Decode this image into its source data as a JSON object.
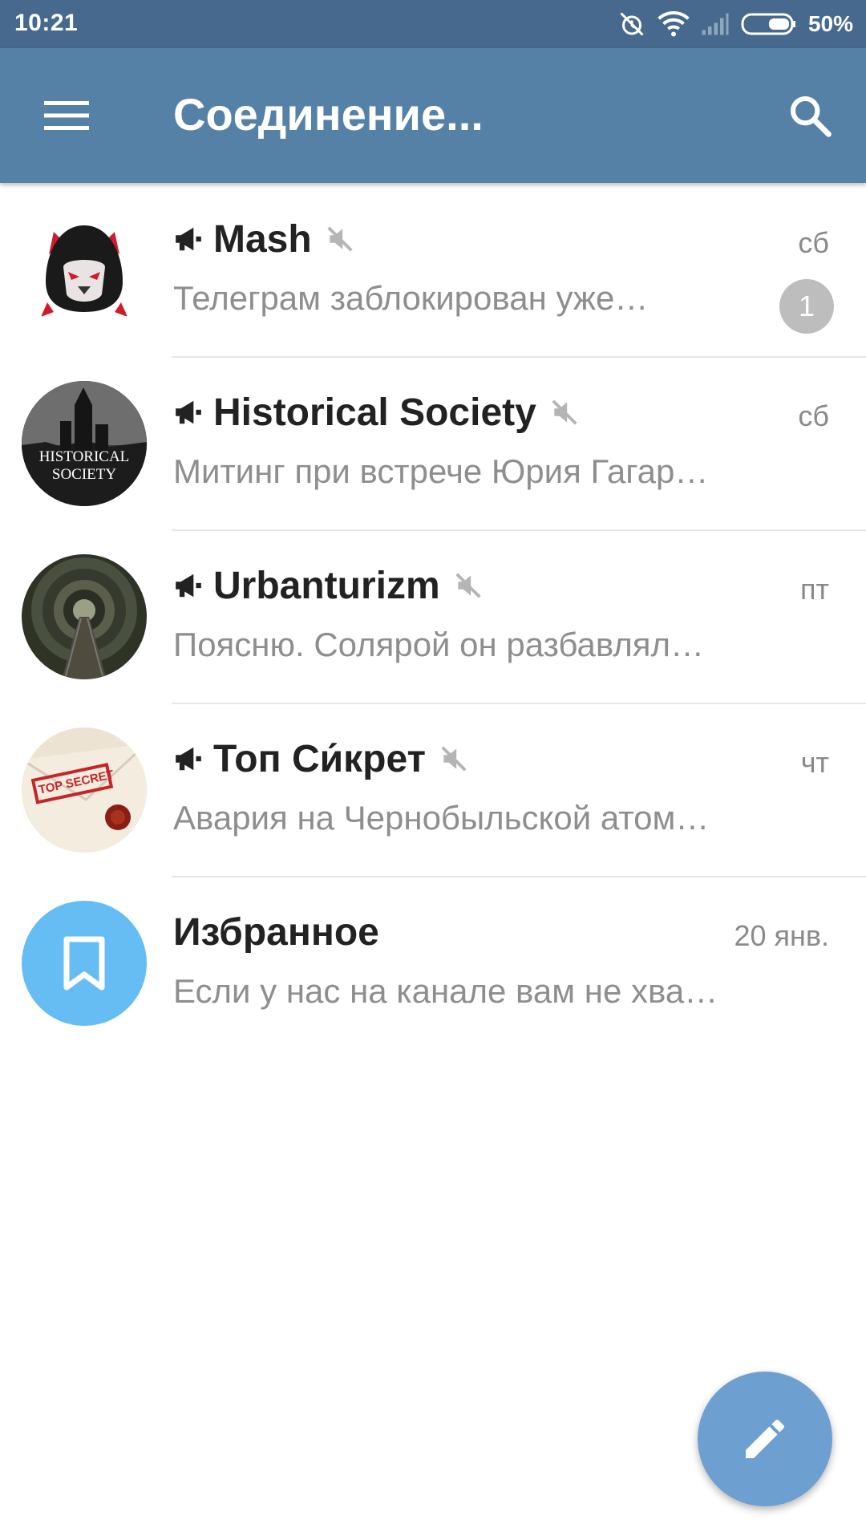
{
  "status_bar": {
    "time": "10:21",
    "battery": "50%",
    "icons": [
      "alarm-off-icon",
      "wifi-icon",
      "signal-icon",
      "battery-icon"
    ]
  },
  "toolbar": {
    "title": "Соединение...",
    "menu_icon": "hamburger-menu-icon",
    "search_icon": "search-icon"
  },
  "chats": [
    {
      "name": "Mash",
      "channel": true,
      "muted": true,
      "date": "сб",
      "preview": "Телеграм заблокирован уже…",
      "unread": "1",
      "avatar": "mash-avatar"
    },
    {
      "name": "Historical Society",
      "channel": true,
      "muted": true,
      "date": "сб",
      "preview": "Митинг при встрече Юрия Гагар…",
      "avatar": "historical-society-avatar",
      "avatar_text_1": "HISTORICAL",
      "avatar_text_2": "SOCIETY"
    },
    {
      "name": "Urbanturizm",
      "channel": true,
      "muted": true,
      "date": "пт",
      "preview": "Поясню. Солярой он разбавлял…",
      "avatar": "tunnel-avatar"
    },
    {
      "name": "Топ Си́крет",
      "channel": true,
      "muted": true,
      "date": "чт",
      "preview": "Авария на Чернобыльской атом…",
      "avatar": "top-secret-avatar",
      "avatar_text": "TOP SECRET"
    },
    {
      "name": "Избранное",
      "channel": false,
      "muted": false,
      "date": "20 янв.",
      "preview": "Если у нас на канале вам не хва…",
      "avatar": "bookmark-avatar"
    }
  ],
  "colors": {
    "status_bar": "#46698d",
    "toolbar": "#5681a7",
    "fab": "#6d9fd1",
    "saved_avatar": "#65bdf3",
    "badge": "#bdbdbd"
  },
  "fab_icon": "pencil-icon"
}
